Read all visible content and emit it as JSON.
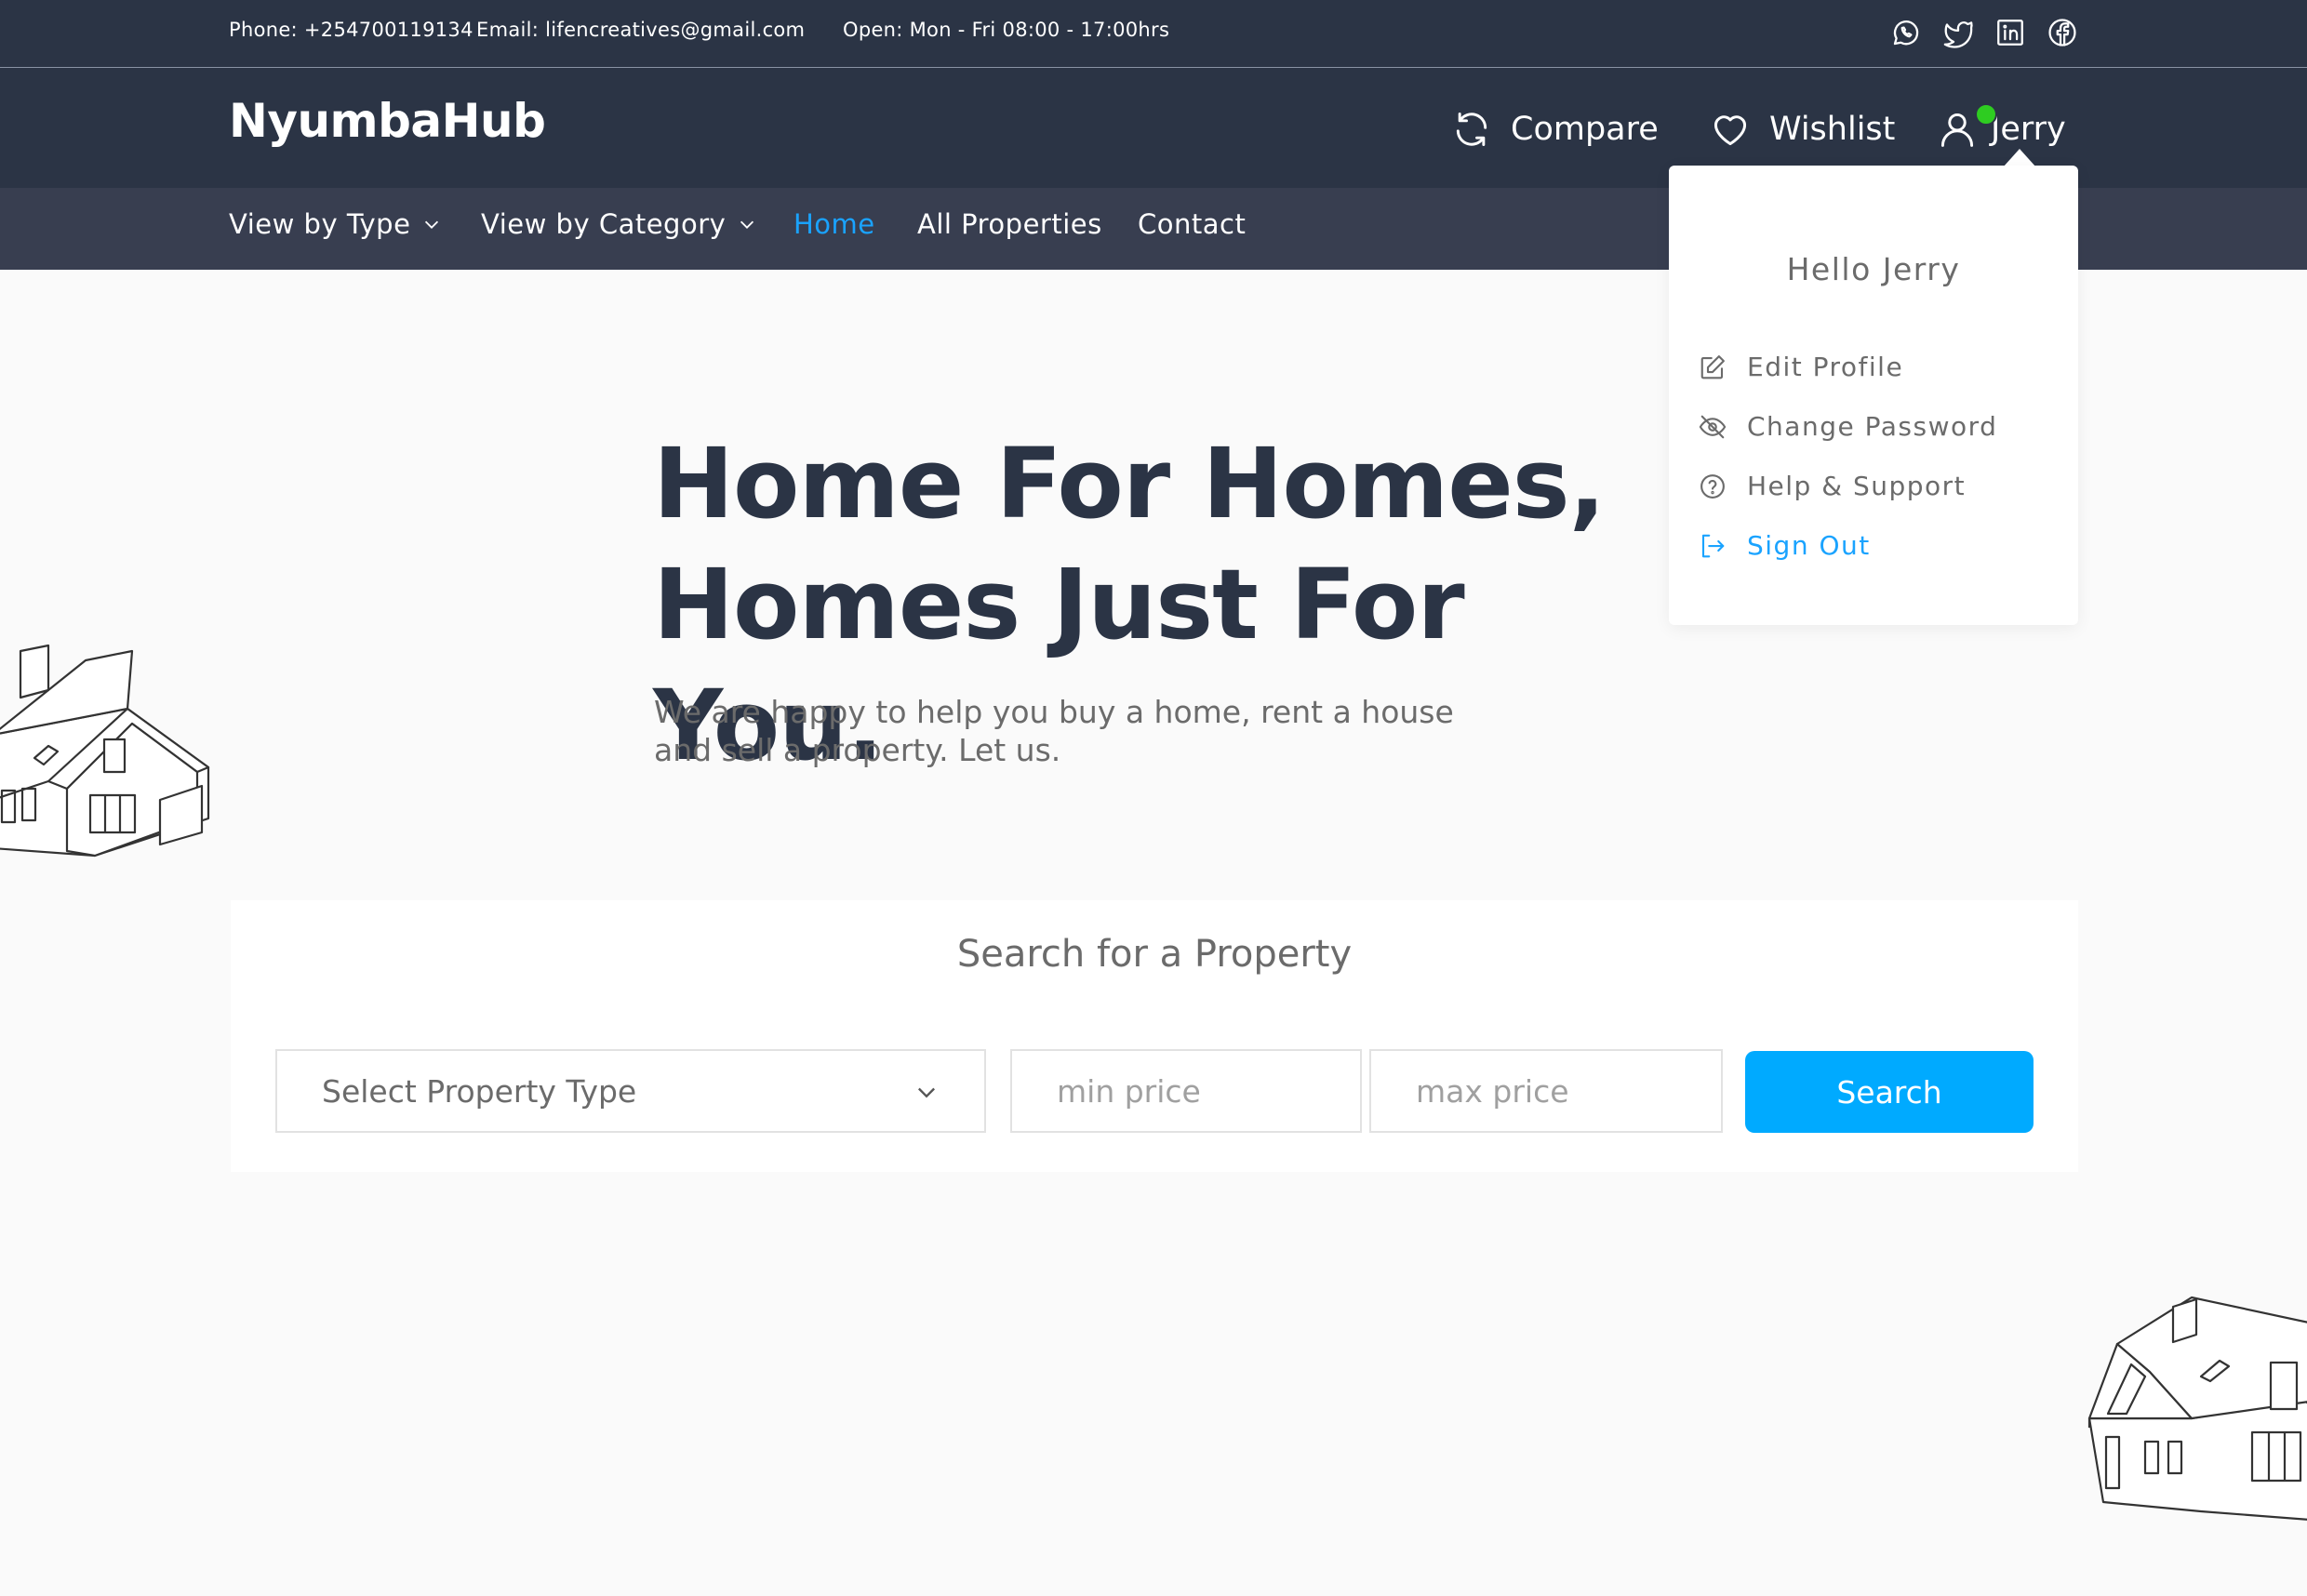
{
  "topbar": {
    "phone": "Phone: +254700119134",
    "email": "Email: lifencreatives@gmail.com",
    "hours": "Open: Mon - Fri 08:00 - 17:00hrs",
    "social_icons": [
      "whatsapp-icon",
      "twitter-icon",
      "linkedin-icon",
      "facebook-icon"
    ]
  },
  "header": {
    "brand": "NyumbaHub",
    "compare_label": "Compare",
    "wishlist_label": "Wishlist",
    "user_name": "Jerry",
    "online_status_color": "#2ecc21"
  },
  "nav": {
    "items": [
      {
        "label": "View by Type",
        "has_dropdown": true
      },
      {
        "label": "View by Category",
        "has_dropdown": true
      },
      {
        "label": "Home",
        "active": true
      },
      {
        "label": "All Properties"
      },
      {
        "label": "Contact"
      }
    ]
  },
  "user_menu": {
    "greeting": "Hello Jerry",
    "items": [
      {
        "label": "Edit Profile",
        "icon": "edit-icon"
      },
      {
        "label": "Change Password",
        "icon": "eye-off-icon"
      },
      {
        "label": "Help & Support",
        "icon": "help-circle-icon"
      },
      {
        "label": "Sign Out",
        "icon": "sign-out-icon"
      }
    ]
  },
  "hero": {
    "title_line1": "Home For Homes,",
    "title_line2": "Homes Just For You.",
    "subtitle": "We are happy to help you buy a home, rent a house and sell a property. Let us."
  },
  "search": {
    "title": "Search for a Property",
    "property_type_placeholder": "Select Property Type",
    "min_price_placeholder": "min price",
    "max_price_placeholder": "max price",
    "button_label": "Search"
  },
  "colors": {
    "header_bg": "#2b3445",
    "nav_bg": "#383e50",
    "accent": "#1aa3ff",
    "button": "#00aaff",
    "page_bg": "#fafafa"
  }
}
